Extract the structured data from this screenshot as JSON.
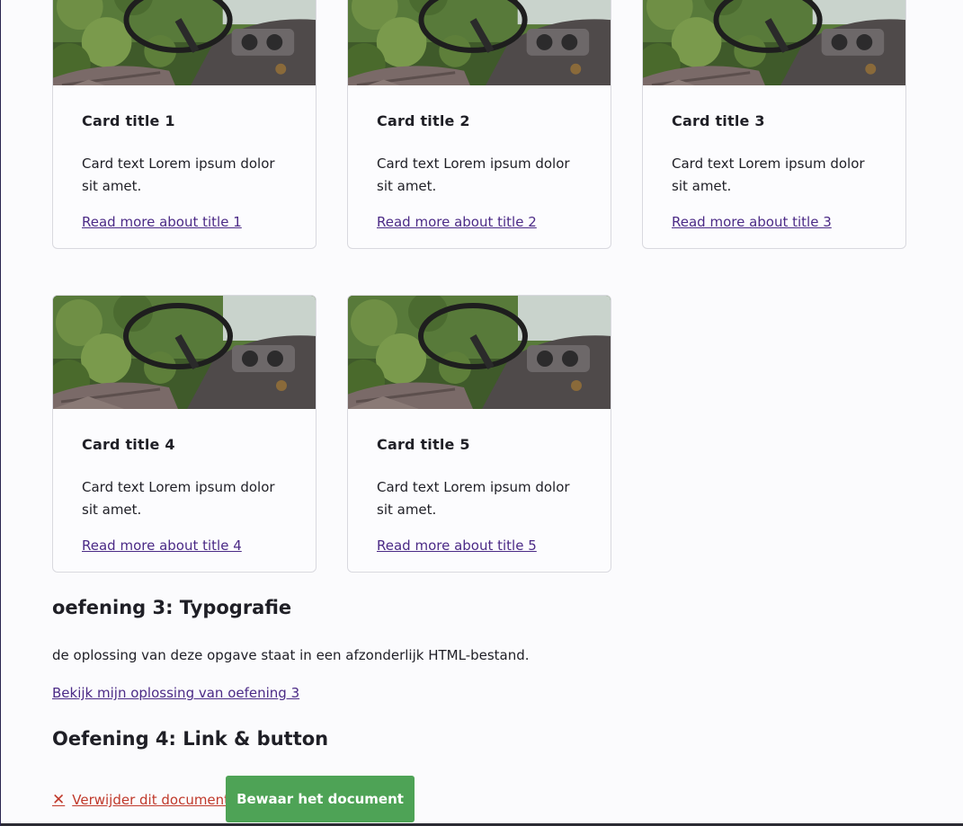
{
  "cards": [
    {
      "title": "Card title 1",
      "text": "Card text Lorem ipsum dolor sit amet.",
      "link": "Read more about title 1"
    },
    {
      "title": "Card title 2",
      "text": "Card text Lorem ipsum dolor sit amet.",
      "link": "Read more about title 2"
    },
    {
      "title": "Card title 3",
      "text": "Card text Lorem ipsum dolor sit amet.",
      "link": "Read more about title 3"
    },
    {
      "title": "Card title 4",
      "text": "Card text Lorem ipsum dolor sit amet.",
      "link": "Read more about title 4"
    },
    {
      "title": "Card title 5",
      "text": "Card text Lorem ipsum dolor sit amet.",
      "link": "Read more about title 5"
    }
  ],
  "exercise3": {
    "title": "oefening 3: Typografie",
    "text": "de oplossing van deze opgave staat in een afzonderlijk HTML-bestand.",
    "link": "Bekijk mijn oplossing van oefening 3"
  },
  "exercise4": {
    "title": "Oefening 4: Link & button",
    "delete_icon": "close-icon",
    "delete_label": "Verwijder dit document",
    "save_label": "Bewaar het document"
  },
  "colors": {
    "link": "#4b2a86",
    "danger": "#c0392b",
    "button": "#4ea356"
  }
}
